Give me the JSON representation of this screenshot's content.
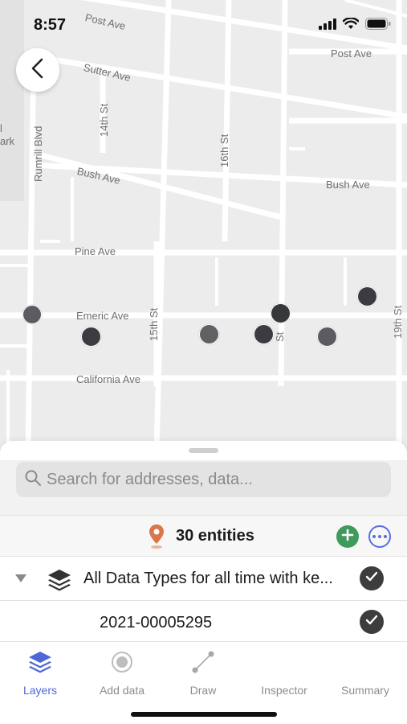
{
  "status_bar": {
    "time": "8:57"
  },
  "map": {
    "streets": {
      "post_ave_left": "Post Ave",
      "post_ave_right": "Post Ave",
      "sutter_ave": "Sutter Ave",
      "bush_ave_left": "Bush Ave",
      "bush_ave_right": "Bush Ave",
      "pine_ave": "Pine Ave",
      "emeric_ave": "Emeric Ave",
      "california_ave": "California Ave",
      "rumrill_blvd": "Rumrill Blvd",
      "st_14th": "14th St",
      "st_15th": "15th St",
      "st_16th": "16th St",
      "st_17th_partial": "St",
      "st_19th": "19th St",
      "park_partial_1": "l",
      "park_partial_2": "ark"
    },
    "marker_color": "#3e4043"
  },
  "sheet": {
    "search": {
      "placeholder": "Search for addresses, data..."
    },
    "entities": {
      "label": "30 entities"
    },
    "layer": {
      "label": "All Data Types for all time with ke..."
    },
    "item": {
      "label": "2021-00005295"
    }
  },
  "tabs": [
    {
      "label": "Layers",
      "icon": "layers-icon",
      "active": true
    },
    {
      "label": "Add data",
      "icon": "add-data-icon",
      "active": false
    },
    {
      "label": "Draw",
      "icon": "draw-icon",
      "active": false
    },
    {
      "label": "Inspector",
      "icon": "inspector-icon",
      "active": false
    },
    {
      "label": "Summary",
      "icon": "summary-icon",
      "active": false
    }
  ],
  "colors": {
    "accent": "#4f67d6",
    "add_green": "#3f9a5c",
    "pin_orange": "#d9774a"
  }
}
